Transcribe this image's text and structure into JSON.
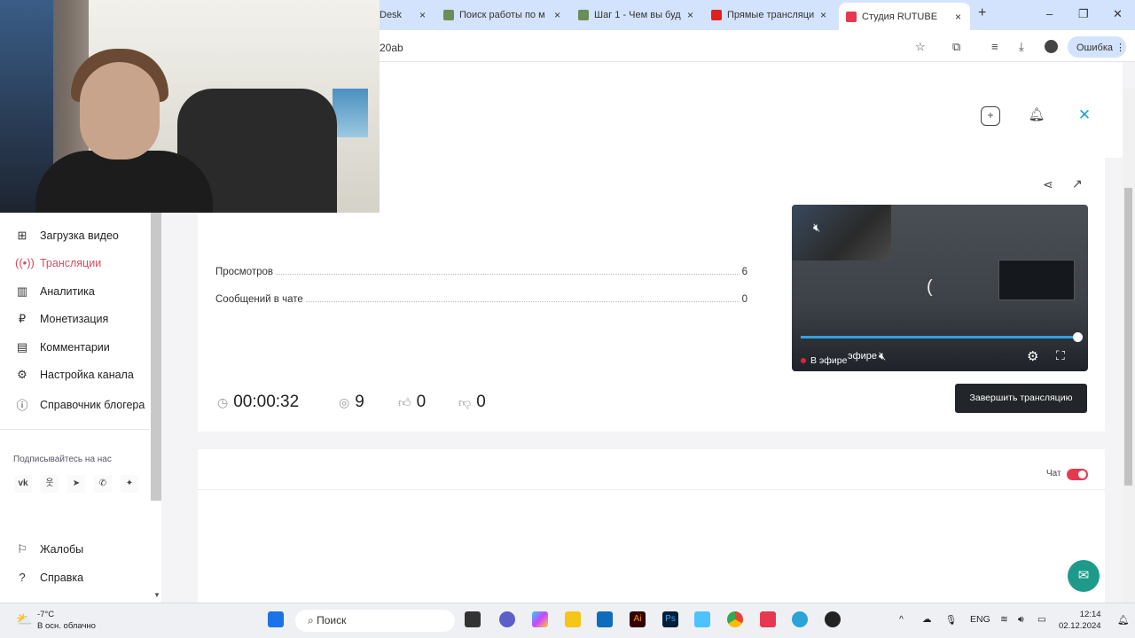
{
  "browser": {
    "tabs": [
      {
        "title": "Desk",
        "active": false
      },
      {
        "title": "Поиск работы по м",
        "active": false
      },
      {
        "title": "Шаг 1 - Чем вы буд",
        "active": false
      },
      {
        "title": "Прямые трансляци",
        "active": false
      },
      {
        "title": "Студия RUTUBE",
        "active": true
      }
    ],
    "close_glyph": "×",
    "new_tab": "+",
    "url": "20ab",
    "profile_error": "Ошибка"
  },
  "sidebar": {
    "items": [
      {
        "label": "Загрузка видео",
        "icon": "upload-icon",
        "active": false
      },
      {
        "label": "Трансляции",
        "icon": "broadcast-icon",
        "active": true
      },
      {
        "label": "Аналитика",
        "icon": "analytics-icon",
        "active": false
      },
      {
        "label": "Монетизация",
        "icon": "ruble-icon",
        "active": false
      },
      {
        "label": "Комментарии",
        "icon": "comment-icon",
        "active": false
      },
      {
        "label": "Настройка канала",
        "icon": "gear-icon",
        "active": false
      },
      {
        "label": "Справочник блогера",
        "icon": "info-icon",
        "active": false
      }
    ],
    "follow_label": "Подписывайтесь на нас",
    "social": [
      "vk",
      "ok",
      "telegram",
      "viber",
      "dzen"
    ],
    "bottom_items": [
      {
        "label": "Жалобы",
        "icon": "flag-icon"
      },
      {
        "label": "Справка",
        "icon": "help-icon"
      }
    ]
  },
  "stats": {
    "views_label": "Просмотров",
    "views_value": "6",
    "chat_label": "Сообщений в чате",
    "chat_value": "0",
    "duration": "00:00:32",
    "viewers": "9",
    "likes": "0",
    "dislikes": "0"
  },
  "player": {
    "live_label": "В эфире",
    "live_label_dup": "эфире",
    "progress": 1.0
  },
  "end_button": "Завершить трансляцию",
  "chat": {
    "label": "Чат",
    "enabled": true
  },
  "taskbar": {
    "weather_temp": "-7°C",
    "weather_desc": "В осн. облачно",
    "search": "Поиск",
    "lang": "ENG",
    "time": "12:14",
    "date": "02.12.2024"
  },
  "colors": {
    "accent": "#d9485f",
    "toggle": "#e8384f",
    "progress": "#2da4e0",
    "help": "#1e9a8a"
  }
}
